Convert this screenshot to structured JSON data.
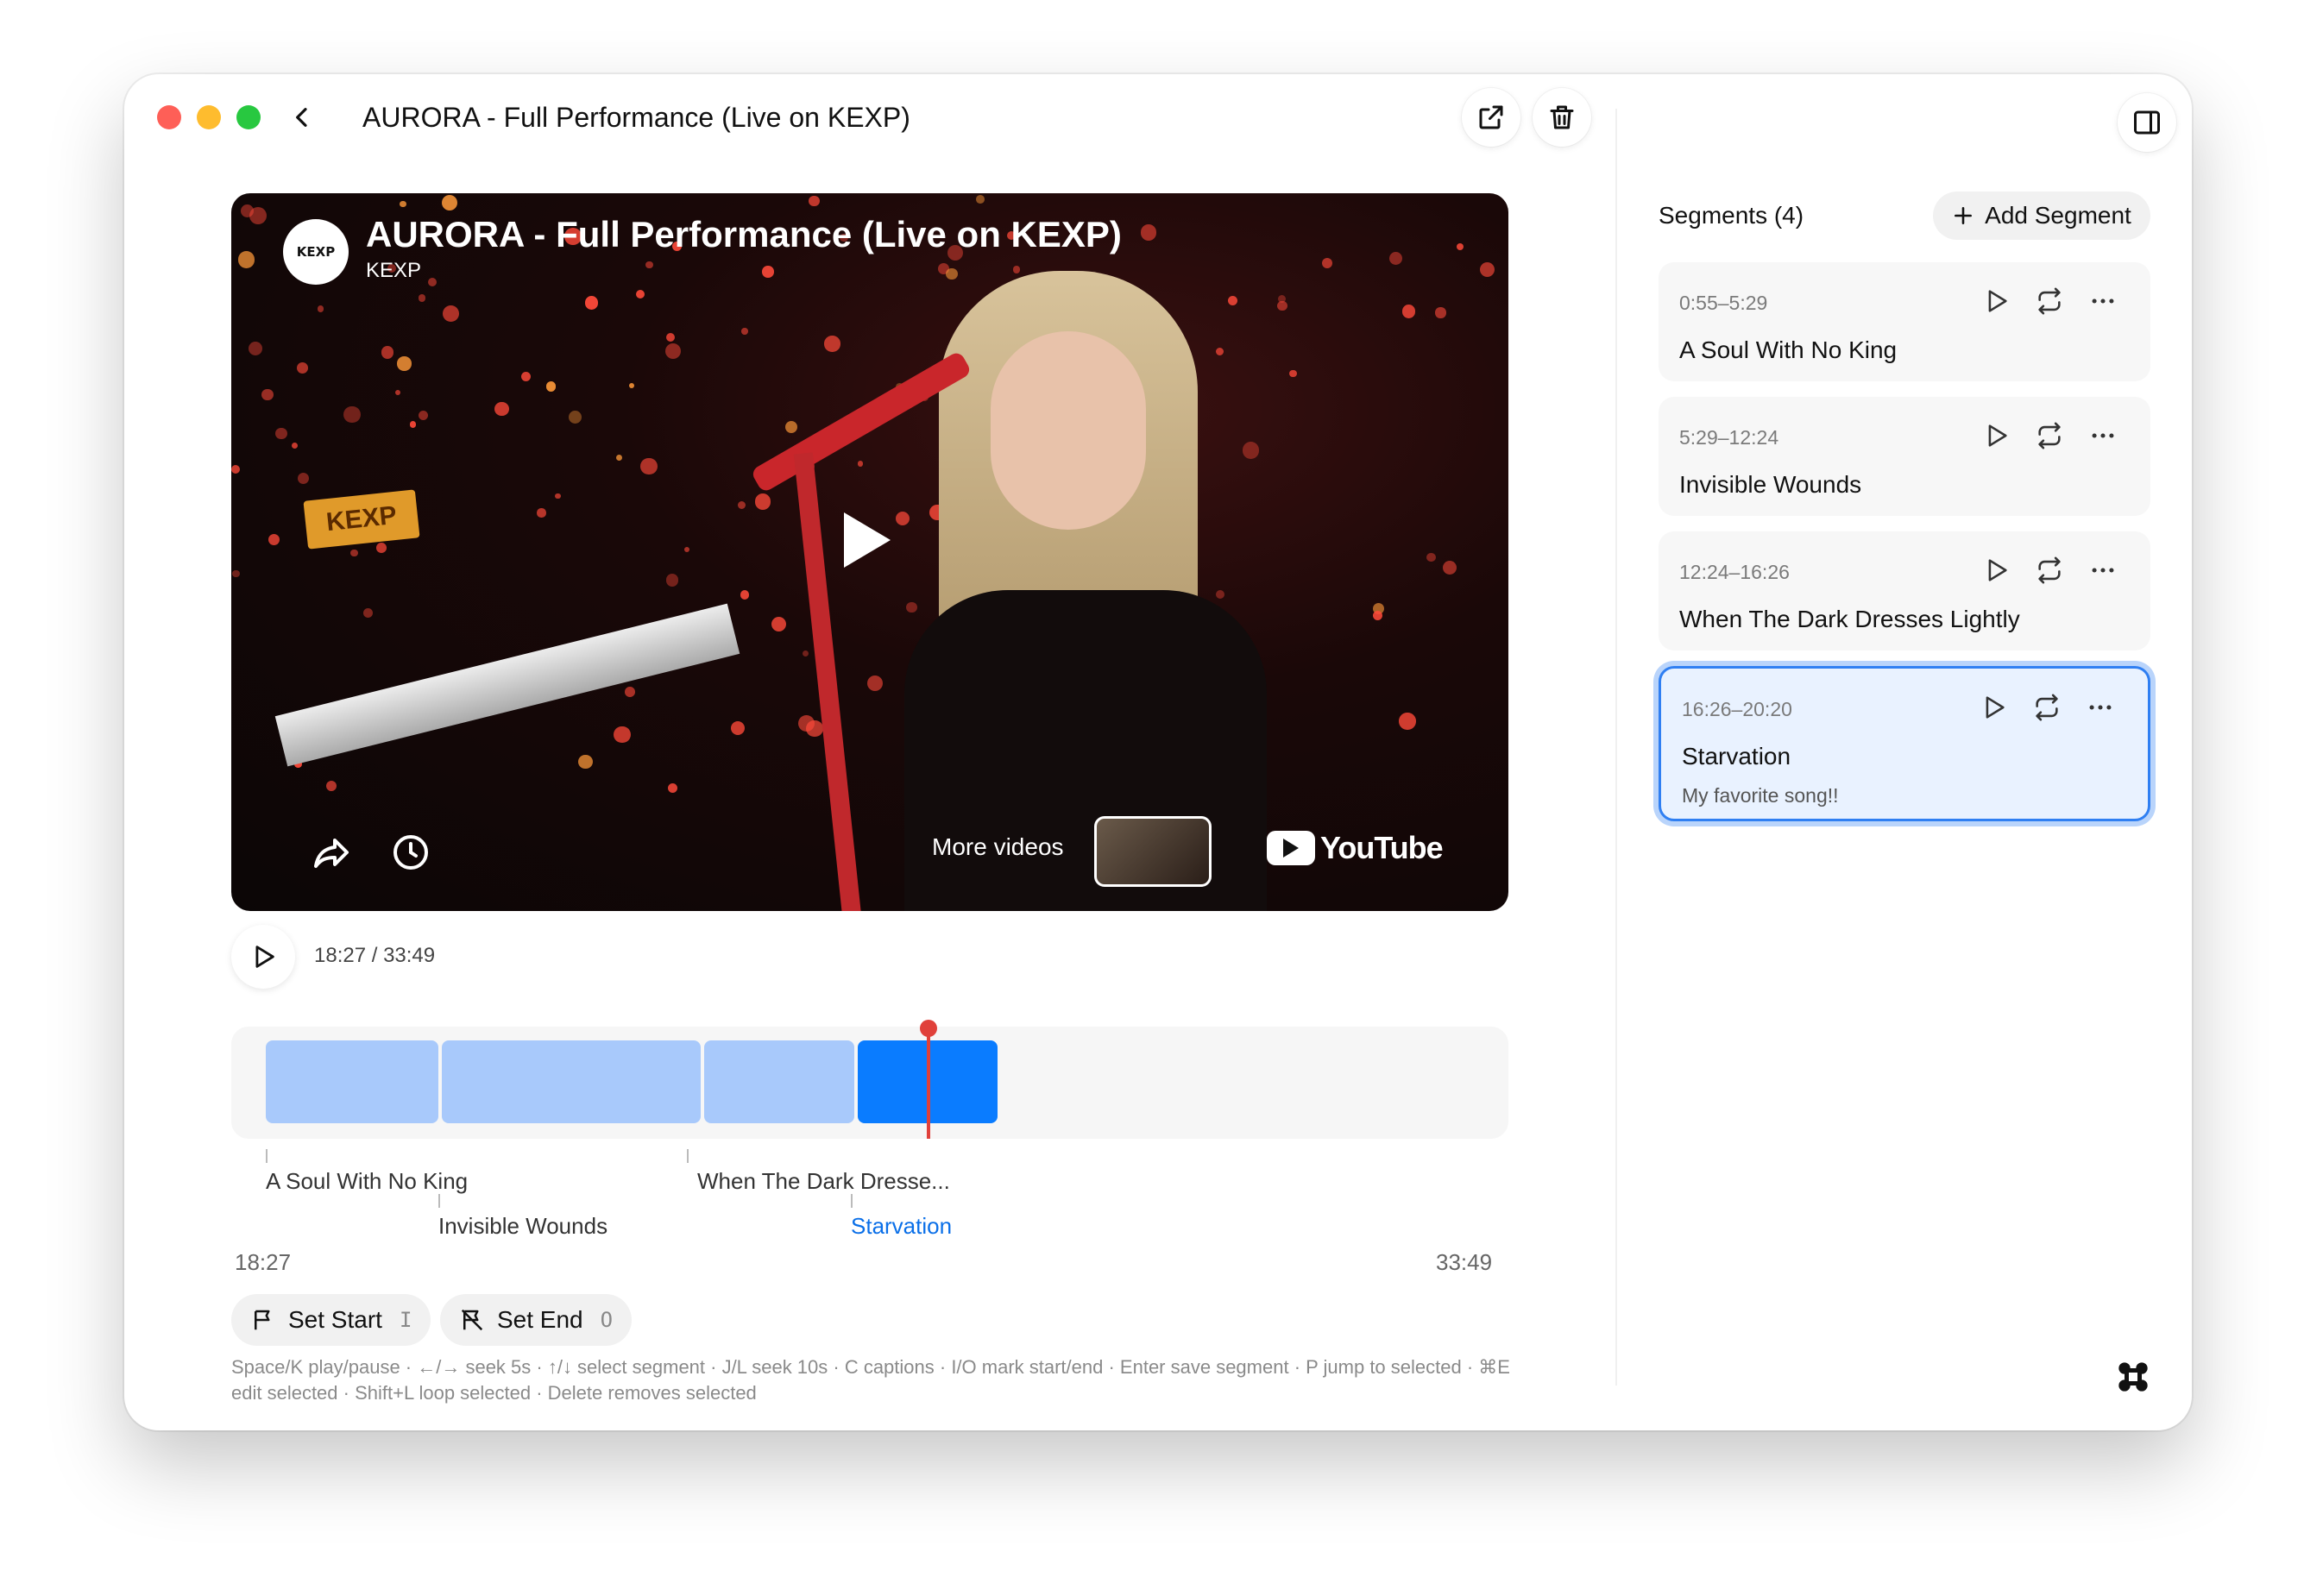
{
  "window": {
    "title": "AURORA - Full Performance (Live on KEXP)"
  },
  "video": {
    "title": "AURORA - Full Performance (Live on KEXP)",
    "channel": "KEXP",
    "logo_text": "KEXP",
    "sign_text": "KEXP",
    "more_videos": "More videos",
    "brand": "YouTube"
  },
  "player": {
    "time": "18:27 / 33:49",
    "range_start": "18:27",
    "range_end": "33:49",
    "progress_fraction": 0.546
  },
  "timeline": {
    "labels": [
      {
        "text": "A Soul With No King",
        "row": 0
      },
      {
        "text": "Invisible Wounds",
        "row": 1
      },
      {
        "text": "When The Dark Dresse...",
        "row": 0
      },
      {
        "text": "Starvation",
        "row": 1
      }
    ]
  },
  "marks": {
    "set_start": "Set Start",
    "set_start_key": "I",
    "set_end": "Set End",
    "set_end_key": "O"
  },
  "shortcuts": "Space/K play/pause · ←/→ seek 5s · ↑/↓ select segment · J/L seek 10s · C captions · I/O mark start/end · Enter save segment · P jump to selected · ⌘E edit selected · Shift+L loop selected · Delete removes selected",
  "segments_panel": {
    "header": "Segments (4)",
    "add_label": "Add Segment",
    "items": [
      {
        "time": "0:55–5:29",
        "title": "A Soul With No King",
        "note": ""
      },
      {
        "time": "5:29–12:24",
        "title": "Invisible Wounds",
        "note": ""
      },
      {
        "time": "12:24–16:26",
        "title": "When The Dark Dresses Lightly",
        "note": ""
      },
      {
        "time": "16:26–20:20",
        "title": "Starvation",
        "note": "My favorite song!!"
      }
    ]
  },
  "colors": {
    "segment_light": "#a8c9fb",
    "segment_active": "#0a7cff",
    "playhead": "#e0403a",
    "selected_border": "#2f7ff2"
  }
}
